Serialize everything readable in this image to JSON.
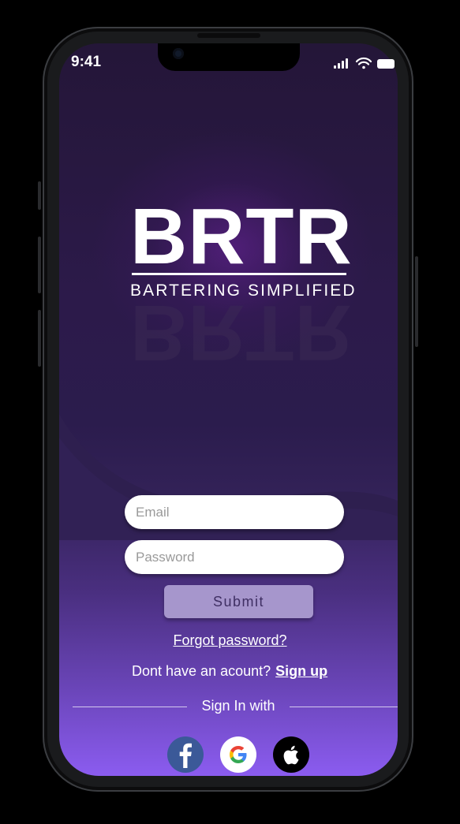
{
  "status_bar": {
    "time": "9:41"
  },
  "brand": {
    "name": "BRTR",
    "tagline": "BARTERING SIMPLIFIED"
  },
  "login_form": {
    "email_placeholder": "Email",
    "password_placeholder": "Password",
    "submit_label": "Submit",
    "forgot_password_label": "Forgot password?",
    "no_account_text": "Dont have an acount?",
    "signup_label": "Sign up"
  },
  "social_login": {
    "divider_text": "Sign In with",
    "providers": [
      {
        "name": "facebook",
        "icon": "facebook-icon",
        "color": "#3b5998"
      },
      {
        "name": "google",
        "icon": "google-icon",
        "color": "#ffffff"
      },
      {
        "name": "apple",
        "icon": "apple-icon",
        "color": "#000000"
      }
    ]
  },
  "colors": {
    "background_top": "#241638",
    "background_bottom": "#8b5cf0",
    "submit_bg": "#a696cc",
    "submit_text": "#3f2f63"
  }
}
